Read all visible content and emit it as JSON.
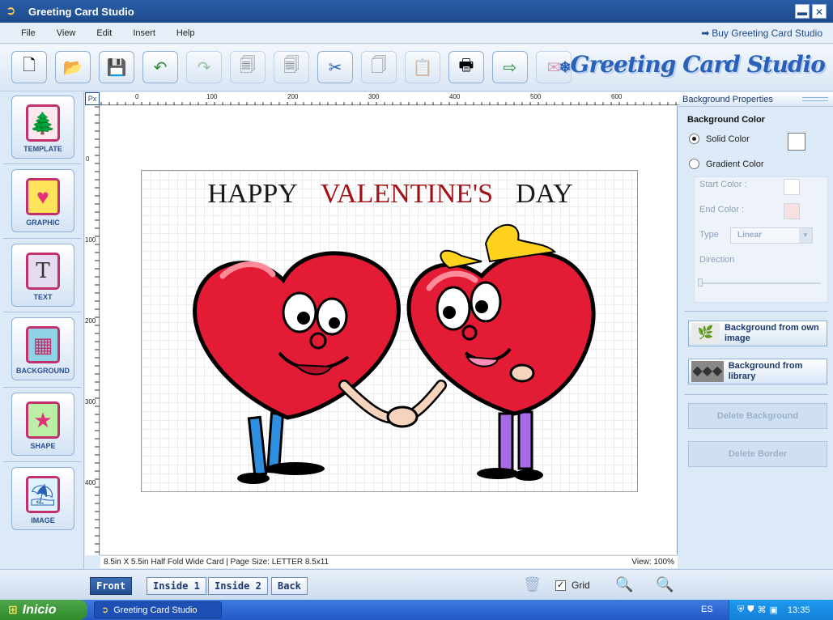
{
  "window": {
    "title": "Greeting Card Studio",
    "minimize": "▬",
    "close": "✕"
  },
  "menu": {
    "items": [
      "File",
      "View",
      "Edit",
      "Insert",
      "Help"
    ],
    "buy_link": "Buy Greeting Card Studio"
  },
  "toolbar": {
    "buttons": [
      {
        "name": "new",
        "icon": "🗋"
      },
      {
        "name": "open",
        "icon": "📂"
      },
      {
        "name": "save",
        "icon": "💾"
      },
      {
        "name": "undo",
        "icon": "↶"
      },
      {
        "name": "redo",
        "icon": "↷"
      },
      {
        "name": "bring-forward",
        "icon": "🗐"
      },
      {
        "name": "send-backward",
        "icon": "🗐"
      },
      {
        "name": "cut",
        "icon": "✂"
      },
      {
        "name": "copy",
        "icon": "🗍"
      },
      {
        "name": "paste",
        "icon": "📋"
      },
      {
        "name": "print",
        "icon": "🖶"
      },
      {
        "name": "export",
        "icon": "⇨"
      },
      {
        "name": "email",
        "icon": "✉"
      }
    ],
    "brand": "Greeting Card Studio"
  },
  "left_panel": {
    "items": [
      {
        "label": "TEMPLATE",
        "icon": "🌲"
      },
      {
        "label": "GRAPHIC",
        "icon": "♥"
      },
      {
        "label": "TEXT",
        "icon": "T"
      },
      {
        "label": "BACKGROUND",
        "icon": "▦"
      },
      {
        "label": "SHAPE",
        "icon": "★"
      },
      {
        "label": "IMAGE",
        "icon": "⛱"
      }
    ]
  },
  "ruler": {
    "unit": "Px",
    "h_labels": [
      "0",
      "100",
      "200",
      "300",
      "400",
      "500",
      "600"
    ],
    "v_labels": [
      "0",
      "100",
      "200",
      "300",
      "400"
    ]
  },
  "card": {
    "headline": {
      "word1": "HAPPY",
      "word2": "VALENTINE'S",
      "word3": "DAY"
    }
  },
  "status": {
    "card_info": "8.5in X 5.5in Half Fold Wide Card | Page Size: LETTER 8.5x11",
    "zoom": "View: 100%"
  },
  "right_panel": {
    "header": "Background Properties",
    "section_title": "Background Color",
    "solid_label": "Solid Color",
    "gradient_label": "Gradient Color",
    "start_color_label": "Start Color :",
    "end_color_label": "End Color :",
    "type_label": "Type",
    "type_value": "Linear",
    "direction_label": "Direction",
    "bg_own_image": "Background from own image",
    "bg_library": "Background from library",
    "delete_background": "Delete Background",
    "delete_border": "Delete Border",
    "end_color_hex": "#f6e1e1"
  },
  "bottom": {
    "tabs": [
      "Front",
      "Inside 1",
      "Inside 2",
      "Back"
    ],
    "grid_label": "Grid",
    "grid_checked": "✓"
  },
  "taskbar": {
    "start": "Inicio",
    "task": "Greeting Card Studio",
    "lang": "ES",
    "clock": "13:35"
  }
}
